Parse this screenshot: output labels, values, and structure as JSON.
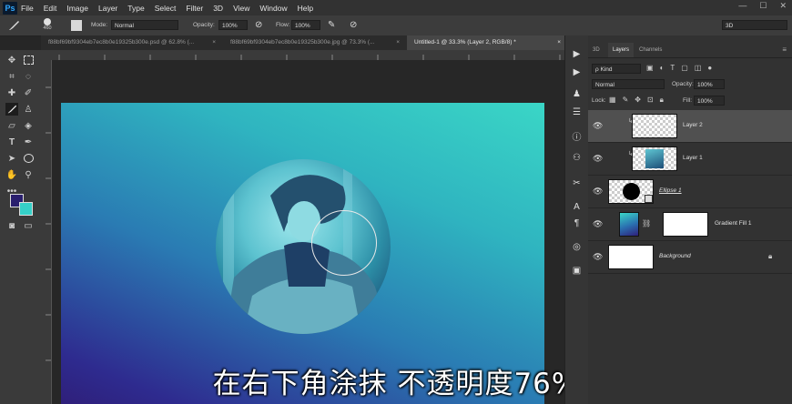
{
  "app": {
    "logo": "Ps"
  },
  "menu": [
    "File",
    "Edit",
    "Image",
    "Layer",
    "Type",
    "Select",
    "Filter",
    "3D",
    "View",
    "Window",
    "Help"
  ],
  "window_controls": [
    "—",
    "☐",
    "✕"
  ],
  "options": {
    "brush_size": "460",
    "mode_label": "Mode:",
    "mode_value": "Normal",
    "opacity_label": "Opacity:",
    "opacity_value": "100%",
    "flow_label": "Flow:",
    "flow_value": "100%",
    "workspace_value": "3D"
  },
  "tabs": [
    {
      "label": "f88bf69bf9304eb7ec8b0e19325b300e.psd @ 62.8% (...",
      "close": "×"
    },
    {
      "label": "f88bf69bf9304eb7ec8b0e19325b300e.jpg @ 73.3% (...",
      "close": "×"
    },
    {
      "label": "Untitled-1 @ 33.3% (Layer 2, RGB/8) *",
      "close": "×"
    }
  ],
  "colors": {
    "foreground": "#2a1f6e",
    "background": "#35d0c8",
    "accent": "#31a8ff"
  },
  "subtitle": "在右下角涂抹  不透明度76%",
  "panel": {
    "tabs": [
      "3D",
      "Layers",
      "Channels"
    ],
    "kind_label": "ρ Kind",
    "blend_mode": "Normal",
    "opacity_label": "Opacity:",
    "opacity_value": "100%",
    "lock_label": "Lock:",
    "fill_label": "Fill:",
    "fill_value": "100%",
    "layers": [
      {
        "name": "Layer 2"
      },
      {
        "name": "Layer 1"
      },
      {
        "name": "Ellipse 1"
      },
      {
        "name": "Gradient Fill 1"
      },
      {
        "name": "Background"
      }
    ]
  }
}
